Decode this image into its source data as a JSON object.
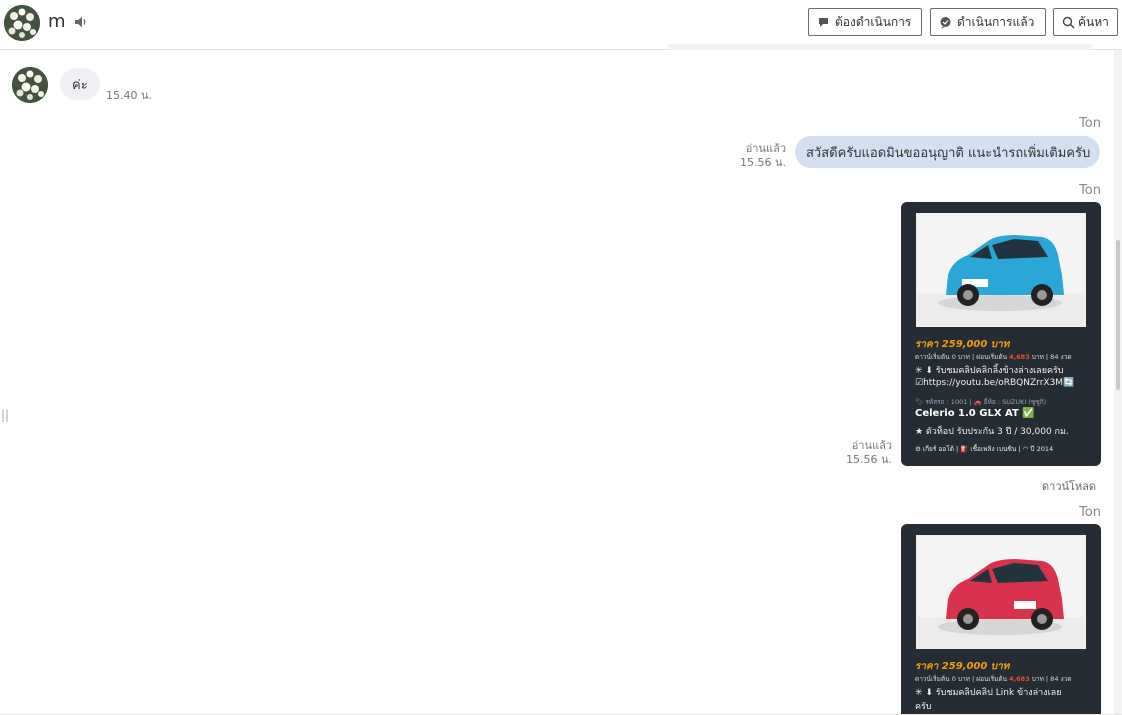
{
  "header": {
    "name": "m",
    "buttons": {
      "need_action": "ต้องดำเนินการ",
      "done": "ดำเนินการแล้ว",
      "search": "ค้นหา"
    }
  },
  "messages": {
    "incoming": {
      "text": "ค่ะ",
      "time": "15.40 น."
    },
    "outgoing1": {
      "sender": "Ton",
      "status": "อ่านแล้ว",
      "time": "15.56 น.",
      "text": "สวัสดีครับแอดมินขออนุญาติ แนะนำรถเพิ่มเติมครับ"
    },
    "card1": {
      "sender": "Ton",
      "status": "อ่านแล้ว",
      "time": "15.56 น.",
      "download": "ดาวน์โหลด",
      "price": "ราคา 259,000 บาท",
      "finance": "ดาวน์เริ่มต้น 0 บาท | ผ่อนเริ่มต้น ",
      "installment": "4,683",
      "finance_tail": " บาท | 84 งวด",
      "clip": "✳ ⬇ รับชมคลิปคลิกลิ้งข้างล่างเลยครับ",
      "link": "☑https://youtu.be/oRBQNZrrX3M🔄",
      "meta": "🏷 รหัสรถ : 1001 | 🚗 ยี่ห้อ : SUZUKI (ซูซูกิ)",
      "model": "Celerio 1.0 GLX AT ✅",
      "warranty": "★ ตัวท็อป รับประกัน 3 ปี / 30,000 กม.",
      "specs": "⚙ เกียร์ ออโต้   |  ⛽ เชื้อเพลิง เบนซิน   |  ◠ ปี 2014",
      "car_color": "#2aa7d6"
    },
    "card2": {
      "sender": "Ton",
      "price": "ราคา 259,000 บาท",
      "finance": "ดาวน์เริ่มต้น 0 บาท | ผ่อนเริ่มต้น ",
      "installment": "4,683",
      "finance_tail": " บาท | 84 งวด",
      "clip": "✳ ⬇ รับชมคลิปคลิป Link ข้างล่างเลย",
      "clip2": "ครับ",
      "car_color": "#d8324d"
    }
  }
}
